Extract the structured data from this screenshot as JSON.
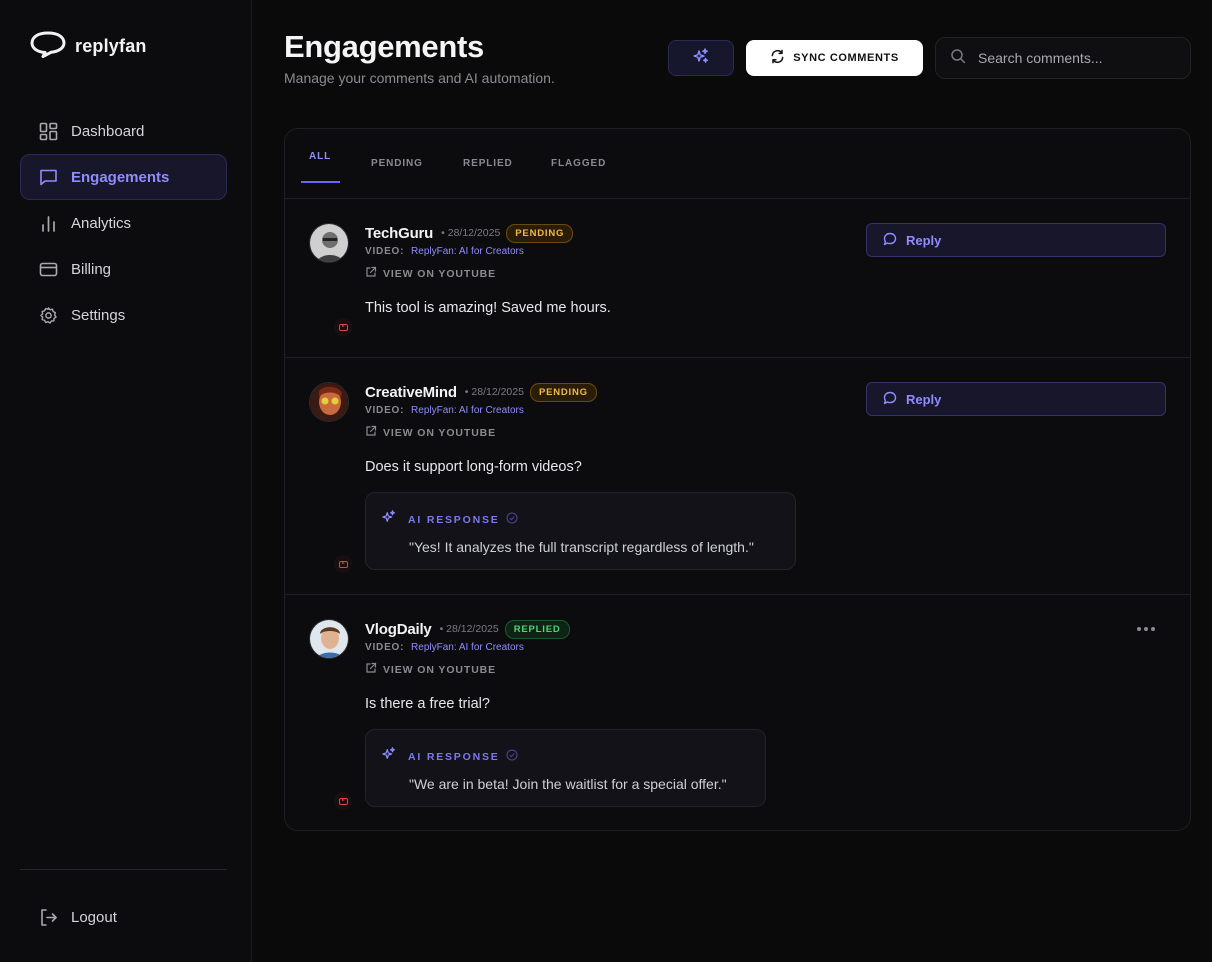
{
  "brand": {
    "name": "replyfan"
  },
  "nav": {
    "items": [
      {
        "label": "Dashboard",
        "icon": "dashboard-icon"
      },
      {
        "label": "Engagements",
        "icon": "chat-icon",
        "active": true
      },
      {
        "label": "Analytics",
        "icon": "bar-chart-icon"
      },
      {
        "label": "Billing",
        "icon": "credit-card-icon"
      },
      {
        "label": "Settings",
        "icon": "gear-icon"
      }
    ],
    "logout_label": "Logout"
  },
  "header": {
    "title": "Engagements",
    "subtitle": "Manage your comments and AI automation.",
    "sync_label": "SYNC COMMENTS",
    "search_placeholder": "Search comments..."
  },
  "tabs": [
    {
      "label": "ALL",
      "active": true
    },
    {
      "label": "PENDING"
    },
    {
      "label": "REPLIED"
    },
    {
      "label": "FLAGGED"
    }
  ],
  "comments": [
    {
      "author": "TechGuru",
      "date": "• 28/12/2025",
      "status": "PENDING",
      "video_label": "VIDEO:",
      "video_title": "ReplyFan: AI for Creators",
      "youtube_link": "VIEW ON YOUTUBE",
      "text": "This tool is amazing! Saved me hours.",
      "action": "Reply"
    },
    {
      "author": "CreativeMind",
      "date": "• 28/12/2025",
      "status": "PENDING",
      "video_label": "VIDEO:",
      "video_title": "ReplyFan: AI for Creators",
      "youtube_link": "VIEW ON YOUTUBE",
      "text": "Does it support long-form videos?",
      "ai_label": "AI RESPONSE",
      "ai_response": "\"Yes! It analyzes the full transcript regardless of length.\"",
      "action": "Reply"
    },
    {
      "author": "VlogDaily",
      "date": "• 28/12/2025",
      "status": "REPLIED",
      "video_label": "VIDEO:",
      "video_title": "ReplyFan: AI for Creators",
      "youtube_link": "VIEW ON YOUTUBE",
      "text": "Is there a free trial?",
      "ai_label": "AI RESPONSE",
      "ai_response": "\"We are in beta! Join the waitlist for a special offer.\""
    }
  ],
  "colors": {
    "accent": "#8f8cff",
    "pending": "#f2b94a",
    "replied": "#4fd47a",
    "youtube": "#e0443c"
  }
}
